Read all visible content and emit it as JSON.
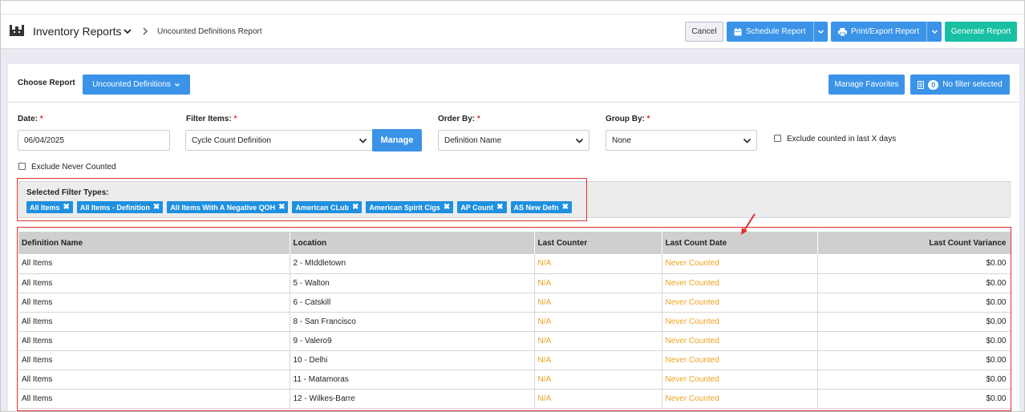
{
  "header": {
    "title": "Inventory Reports",
    "breadcrumb": "Uncounted Definitions Report",
    "cancel_label": "Cancel",
    "schedule_label": "Schedule Report",
    "print_label": "Print/Export Report",
    "generate_label": "Generate Report"
  },
  "report_bar": {
    "choose_label": "Choose Report",
    "selected_report": "Uncounted Definitions",
    "manage_favorites_label": "Manage Favorites",
    "filter_count": "0",
    "no_filter_label": "No filter selected"
  },
  "form": {
    "date_label": "Date:",
    "date_value": "06/04/2025",
    "filter_items_label": "Filter Items:",
    "filter_items_value": "Cycle Count Definition",
    "manage_label": "Manage",
    "order_by_label": "Order By:",
    "order_by_value": "Definition Name",
    "group_by_label": "Group By:",
    "group_by_value": "None",
    "exclude_counted_label": "Exclude counted in last X days",
    "exclude_never_label": "Exclude Never Counted",
    "required_mark": "*"
  },
  "filters": {
    "title": "Selected Filter Types:",
    "tags": [
      "All Items",
      "All Items - Definition",
      "All Items With A Negative QOH",
      "American CLub",
      "American Spirit Cigs",
      "AP Count",
      "AS New Defn"
    ]
  },
  "table": {
    "columns": [
      "Definition Name",
      "Location",
      "Last Counter",
      "Last Count Date",
      "Last Count Variance"
    ],
    "rows": [
      [
        "All Items",
        "2 - MIddletown",
        "N/A",
        "Never Counted",
        "$0.00"
      ],
      [
        "All Items",
        "5 - Walton",
        "N/A",
        "Never Counted",
        "$0.00"
      ],
      [
        "All Items",
        "6 - Catskill",
        "N/A",
        "Never Counted",
        "$0.00"
      ],
      [
        "All Items",
        "8 - San Francisco",
        "N/A",
        "Never Counted",
        "$0.00"
      ],
      [
        "All Items",
        "9 - Valero9",
        "N/A",
        "Never Counted",
        "$0.00"
      ],
      [
        "All Items",
        "10 - Delhi",
        "N/A",
        "Never Counted",
        "$0.00"
      ],
      [
        "All Items",
        "11 - Matamoras",
        "N/A",
        "Never Counted",
        "$0.00"
      ],
      [
        "All Items",
        "12 - Wilkes-Barre",
        "N/A",
        "Never Counted",
        "$0.00"
      ]
    ]
  },
  "colors": {
    "primary": "#3b93e8",
    "teal": "#18bfa3",
    "tag": "#1f90e0",
    "status_orange": "#f0a020",
    "highlight_red": "#e0302e"
  }
}
